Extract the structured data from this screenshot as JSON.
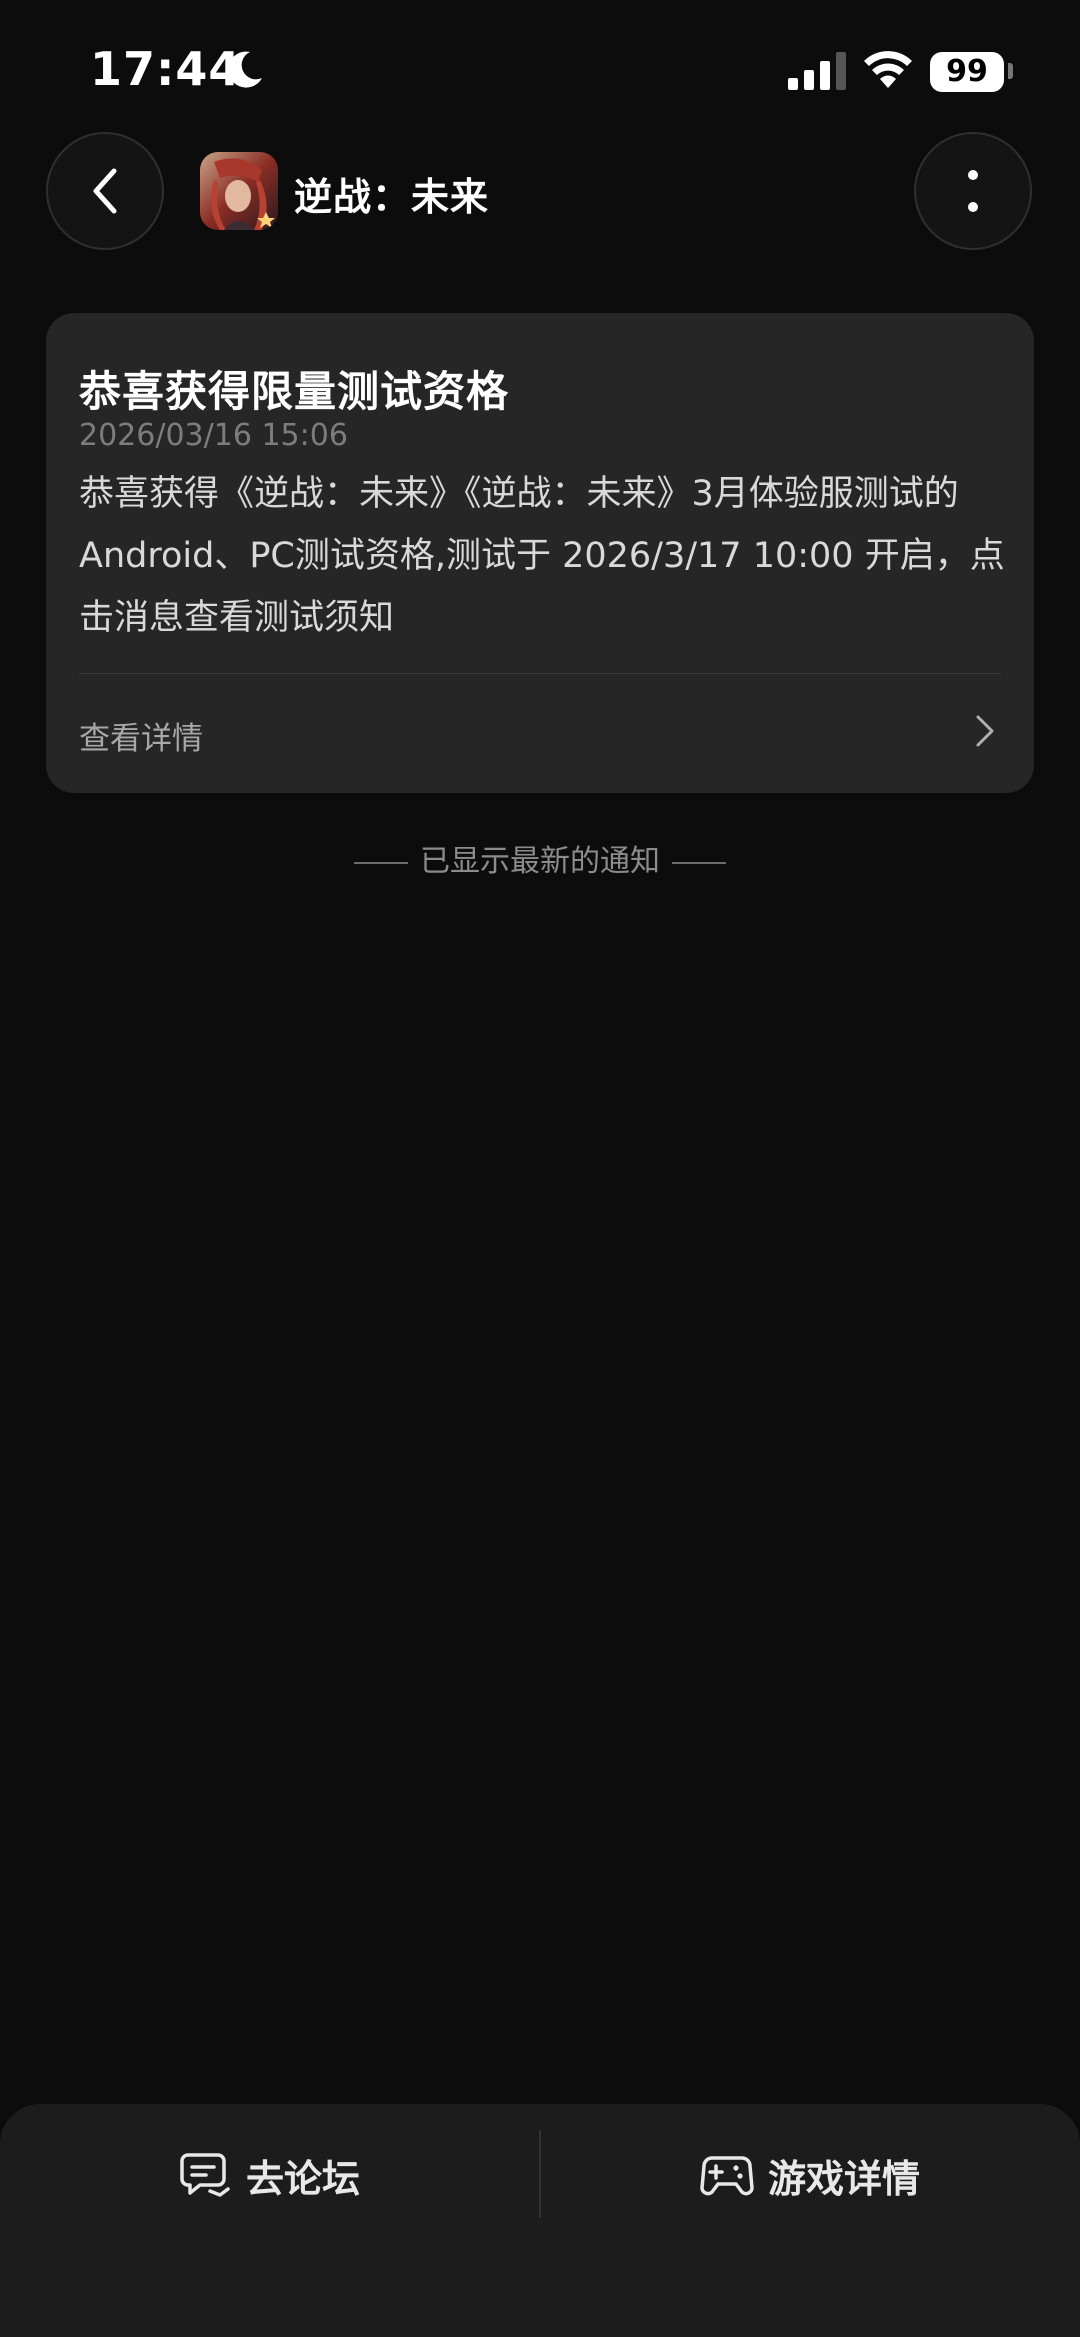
{
  "status_bar": {
    "time": "17:44",
    "battery": "99"
  },
  "header": {
    "app_name": "逆战：未来"
  },
  "notification": {
    "title": "恭喜获得限量测试资格",
    "timestamp": "2026/03/16 15:06",
    "body": "恭喜获得《逆战：未来》《逆战：未来》3月体验服测试的Android、PC测试资格,测试于 2026/3/17 10:00 开启，点击消息查看测试须知",
    "link_label": "查看详情"
  },
  "end_note": "已显示最新的通知",
  "bottom_bar": {
    "forum_label": "去论坛",
    "game_detail_label": "游戏详情"
  },
  "colors": {
    "background": "#0c0c0c",
    "card": "#262626",
    "bottom_bar": "#1c1c1c"
  }
}
